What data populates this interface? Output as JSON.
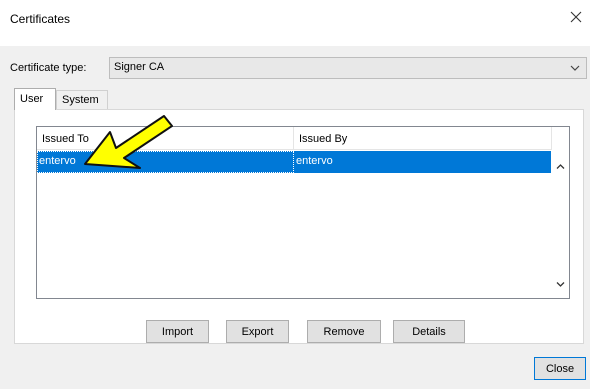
{
  "window": {
    "title": "Certificates"
  },
  "certificate_type": {
    "label": "Certificate type:",
    "value": "Signer CA"
  },
  "tabs": [
    {
      "label": "User",
      "active": true
    },
    {
      "label": "System",
      "active": false
    }
  ],
  "list": {
    "columns": [
      "Issued To",
      "Issued By"
    ],
    "rows": [
      {
        "issued_to": "entervo",
        "issued_by": "entervo",
        "selected": true
      }
    ]
  },
  "buttons": {
    "import": "Import",
    "export": "Export",
    "remove": "Remove",
    "details": "Details",
    "close": "Close"
  },
  "colors": {
    "selection": "#0078d7",
    "annotation_arrow": "#ffff00"
  },
  "icons": {
    "close": "close-icon",
    "dropdown": "chevron-down-icon",
    "scroll_up": "chevron-up-icon",
    "scroll_down": "chevron-down-icon",
    "annotation": "arrow-annotation-icon"
  }
}
